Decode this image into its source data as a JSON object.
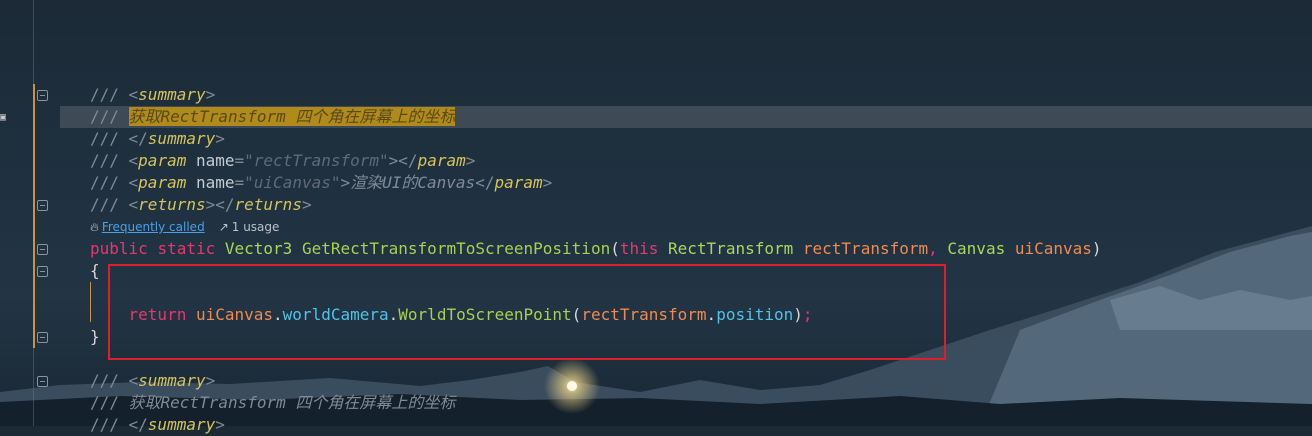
{
  "editor": {
    "lines": {
      "l1_tag": "summary",
      "l2_text": "获取RectTransform 四个角在屏幕上的坐标",
      "l3_tag": "summary",
      "l4_tag": "param",
      "l4_attr": "name",
      "l4_value": "\"rectTransform\"",
      "l4_close": "param",
      "l5_tag": "param",
      "l5_attr": "name",
      "l5_value": "\"uiCanvas\"",
      "l5_text": "渲染UI的Canvas",
      "l5_close": "param",
      "l6_tag": "returns",
      "l6_close": "returns",
      "hint_link": "Frequently called",
      "hint_usage": "1 usage",
      "sig_public": "public",
      "sig_static": "static",
      "sig_type": "Vector3",
      "sig_method": "GetRectTransformToScreenPosition",
      "sig_this": "this",
      "sig_ptype1": "RectTransform",
      "sig_pname1": "rectTransform",
      "sig_ptype2": "Canvas",
      "sig_pname2": "uiCanvas",
      "brace_open": "{",
      "ret_kw": "return",
      "ret_obj": "uiCanvas",
      "ret_prop": "worldCamera",
      "ret_method": "WorldToScreenPoint",
      "ret_arg": "rectTransform",
      "ret_argprop": "position",
      "brace_close": "}",
      "l12_tag": "summary",
      "l13_text": "获取RectTransform 四个角在屏幕上的坐标",
      "l14_tag": "summary"
    },
    "icons": {
      "hint_fire": "flame-icon",
      "hint_usage": "open-in-icon",
      "bookmark": "bookmark-icon"
    },
    "colors": {
      "keyword": "#e8376d",
      "type": "#a7d85a",
      "parameter": "#f08a4e",
      "property": "#52c2e6",
      "highlight": "#b18a1c",
      "annotation_box": "#e01e2a"
    }
  }
}
